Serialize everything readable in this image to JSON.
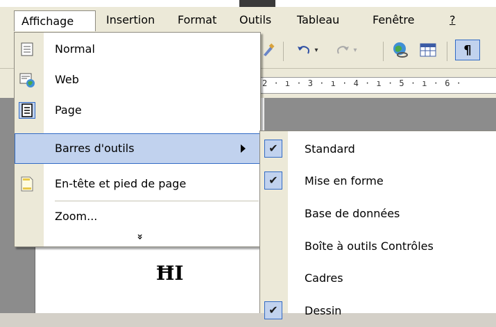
{
  "menubar": {
    "items": [
      "Affichage",
      "Insertion",
      "Format",
      "Outils",
      "Tableau",
      "Fenêtre",
      "?"
    ]
  },
  "ruler": {
    "text": "2 · ı · 3 · ı · 4 · ı · 5 · ı · 6 ·"
  },
  "affichage_menu": {
    "items": [
      {
        "label": "Normal",
        "icon": "normal-view-icon"
      },
      {
        "label": "Web",
        "icon": "web-layout-icon"
      },
      {
        "label": "Page",
        "icon": "page-layout-icon",
        "active": true
      },
      {
        "label": "Barres d'outils",
        "submenu": true,
        "highlighted": true
      },
      {
        "label": "En-tête et pied de page",
        "icon": "header-footer-icon"
      },
      {
        "label": "Zoom..."
      }
    ],
    "more_glyph": "»"
  },
  "toolbars_submenu": {
    "items": [
      {
        "label": "Standard",
        "checked": true
      },
      {
        "label": "Mise en forme",
        "checked": true
      },
      {
        "label": "Base de données",
        "checked": false
      },
      {
        "label": "Boîte à outils Contrôles",
        "checked": false
      },
      {
        "label": "Cadres",
        "checked": false
      },
      {
        "label": "Dessin",
        "checked": true
      }
    ]
  },
  "toolbar": {
    "pilcrow": "¶"
  },
  "document": {
    "cursor_glyph": "ĦI"
  },
  "colors": {
    "highlight": "#c1d2ee",
    "highlight_border": "#316ac5",
    "menu_bg": "#ece9d8"
  }
}
